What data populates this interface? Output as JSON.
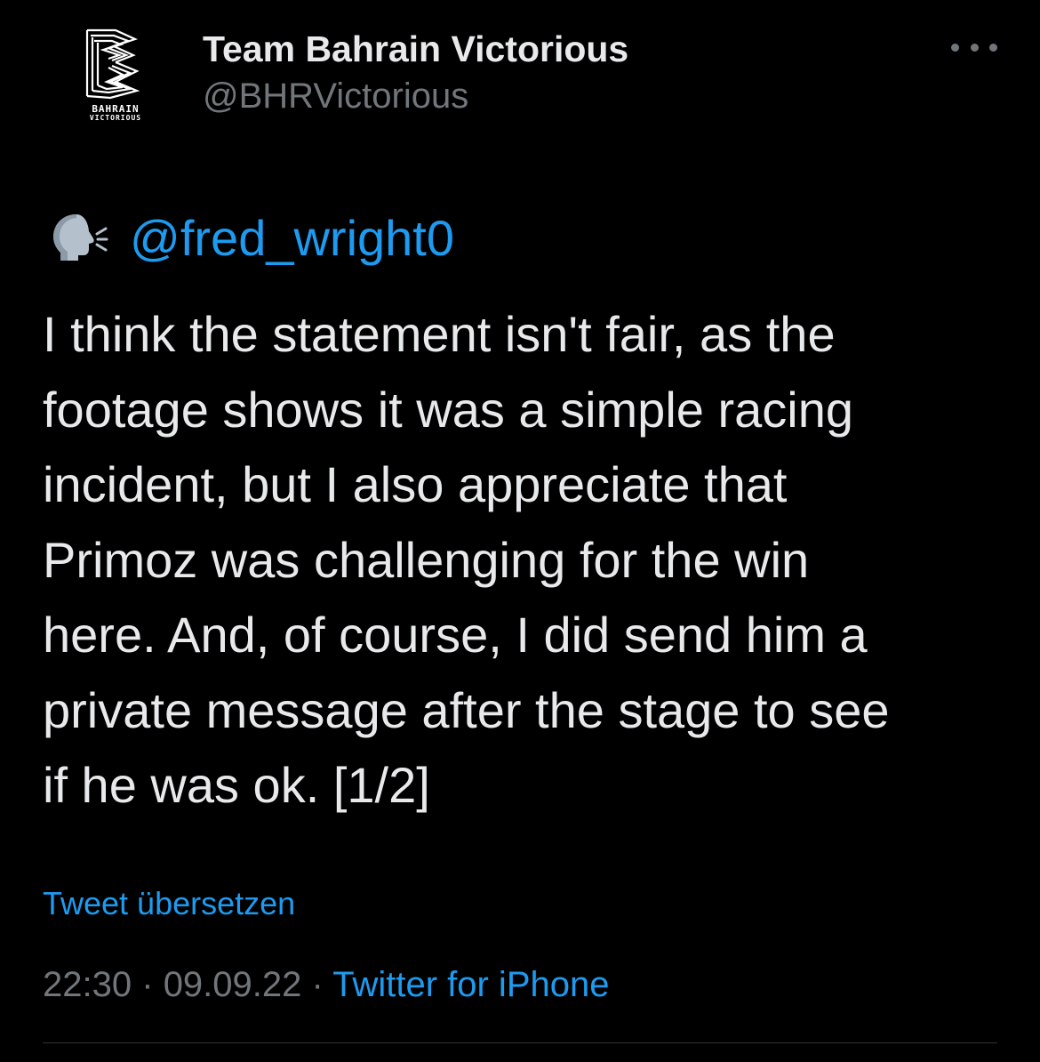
{
  "account": {
    "display_name": "Team Bahrain Victorious",
    "handle": "@BHRVictorious",
    "avatar_text_line1": "BAHRAIN",
    "avatar_text_line2": "VICTORIOUS"
  },
  "tweet": {
    "speaking_emoji": "speaking-head-icon",
    "mention": "@fred_wright0",
    "text_lines": [
      "I think the statement isn't fair, as the",
      "footage shows it was a simple racing",
      "incident, but I also appreciate that",
      "Primoz was challenging for the win",
      "here. And, of course, I did send him a",
      "private message after the stage to see",
      "if he was ok. [1/2]"
    ],
    "translate_label": "Tweet übersetzen",
    "time": "22:30",
    "separator": "·",
    "date": "09.09.22",
    "source": "Twitter for iPhone"
  },
  "colors": {
    "background": "#000000",
    "text": "#e7e9ea",
    "secondary": "#71767b",
    "accent": "#1d9bf0",
    "divider": "#2f3336"
  },
  "icons": {
    "more": "more-horizontal-icon",
    "logo": "bahrain-victorious-logo"
  }
}
